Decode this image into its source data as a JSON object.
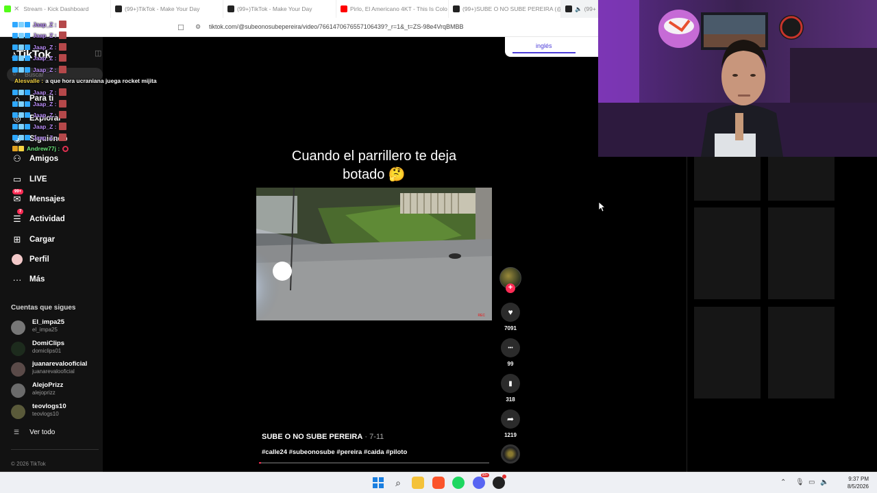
{
  "browser": {
    "tabs": [
      {
        "title": "Stream - Kick Dashboard",
        "icon": "kick-icon",
        "color": "#53fc18"
      },
      {
        "title": "(99+)TikTok - Make Your Day",
        "icon": "tiktok-icon",
        "color": "#111111"
      },
      {
        "title": "(99+)TikTok - Make Your Day",
        "icon": "tiktok-icon",
        "color": "#111111"
      },
      {
        "title": "Pirlo, El Americano 4KT - This Is Colo",
        "icon": "youtube-icon",
        "color": "#ff0000"
      },
      {
        "title": "(99+)SUBE O NO SUBE PEREIRA (@s",
        "icon": "tiktok-icon",
        "color": "#111111"
      },
      {
        "title": "(99+",
        "icon": "tiktok-icon",
        "color": "#111111"
      }
    ],
    "url": "tiktok.com/@subeonosubepereira/video/7661470676557106439?_r=1&_t=ZS-98e4VrqBMBB"
  },
  "sidebar": {
    "logo": "TikTok",
    "search_placeholder": "Buscar",
    "nav": [
      {
        "label": "Para ti",
        "icon": "home-icon"
      },
      {
        "label": "Explorar",
        "icon": "compass-icon"
      },
      {
        "label": "Siguiendo",
        "icon": "following-icon"
      },
      {
        "label": "Amigos",
        "icon": "friends-icon"
      },
      {
        "label": "LIVE",
        "icon": "live-icon"
      },
      {
        "label": "Mensajes",
        "icon": "messages-icon",
        "badge": "99+"
      },
      {
        "label": "Actividad",
        "icon": "activity-icon",
        "badge": "7"
      },
      {
        "label": "Cargar",
        "icon": "upload-icon"
      },
      {
        "label": "Perfil",
        "icon": "profile-icon"
      },
      {
        "label": "Más",
        "icon": "more-icon"
      }
    ],
    "following_title": "Cuentas que sigues",
    "following": [
      {
        "name": "El_impa25",
        "handle": "el_impa25"
      },
      {
        "name": "DomiClips",
        "handle": "domiclips01"
      },
      {
        "name": "juanarevalooficial",
        "handle": "juanarevalooficial"
      },
      {
        "name": "AlejoPrizz",
        "handle": "alejoprizz"
      },
      {
        "name": "teovlogs10",
        "handle": "teovlogs10"
      }
    ],
    "see_all": "Ver todo",
    "copyright": "© 2026 TikTok"
  },
  "chat": [
    {
      "user": "Jaap_Z :",
      "color": "#b98cf7",
      "text": ""
    },
    {
      "user": "Jaap_Z :",
      "color": "#b98cf7",
      "text": ""
    },
    {
      "user": "Jaap_Z :",
      "color": "#b98cf7",
      "text": ""
    },
    {
      "user": "Jaap_Z :",
      "color": "#b98cf7",
      "text": ""
    },
    {
      "user": "Jaap_Z :",
      "color": "#b98cf7",
      "text": ""
    },
    {
      "user": "Alesvalle :",
      "color": "#f5d442",
      "text": "a que hora ucraniana juega rocket mijita"
    },
    {
      "user": "Jaap_Z :",
      "color": "#b98cf7",
      "text": ""
    },
    {
      "user": "Jaap_Z :",
      "color": "#b98cf7",
      "text": ""
    },
    {
      "user": "Jaap_Z :",
      "color": "#b98cf7",
      "text": ""
    },
    {
      "user": "Jaap_Z :",
      "color": "#b98cf7",
      "text": ""
    },
    {
      "user": "Jaap_Z :",
      "color": "#b98cf7",
      "text": ""
    },
    {
      "user": "Andrew77j :",
      "color": "#6ee87e",
      "text": ""
    }
  ],
  "video": {
    "title_line1": "Cuando el parrillero te deja",
    "title_line2": "botado 🤔",
    "rec_label": "REC",
    "author": "SUBE O NO SUBE PEREIRA",
    "date": " · 7-11",
    "hashtags": "#calle24 #subeonosube #pereira #caida #piloto",
    "progress_fraction": 0.01
  },
  "actions": [
    {
      "name": "like",
      "icon": "heart-icon",
      "glyph": "♥",
      "count": "7091"
    },
    {
      "name": "comment",
      "icon": "comment-icon",
      "glyph": "•••",
      "count": "99"
    },
    {
      "name": "save",
      "icon": "bookmark-icon",
      "glyph": "▮",
      "count": "318"
    },
    {
      "name": "share",
      "icon": "share-icon",
      "glyph": "➦",
      "count": "1219"
    }
  ],
  "right_panel": {
    "tab_label": "inglés"
  },
  "taskbar": {
    "time": "9:37 PM",
    "date": "8/5/2026",
    "badge": "99+"
  }
}
